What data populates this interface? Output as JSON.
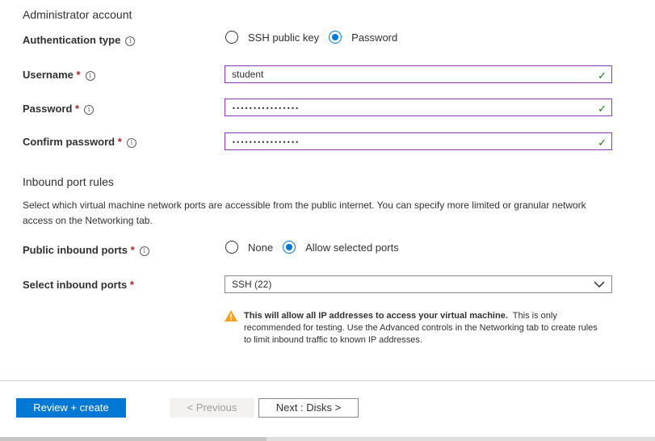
{
  "admin": {
    "section_title": "Administrator account",
    "auth_type_label": "Authentication type",
    "auth_options": [
      "SSH public key",
      "Password"
    ],
    "auth_selected": "Password",
    "username_label": "Username",
    "username_value": "student",
    "password_label": "Password",
    "password_value": "••••••••••••••••",
    "confirm_label": "Confirm password",
    "confirm_value": "••••••••••••••••",
    "required_mark": "*",
    "info_glyph": "i",
    "valid_glyph": "✓"
  },
  "inbound": {
    "section_title": "Inbound port rules",
    "description": "Select which virtual machine network ports are accessible from the public internet. You can specify more limited or granular network access on the Networking tab.",
    "public_ports_label": "Public inbound ports",
    "public_ports_options": [
      "None",
      "Allow selected ports"
    ],
    "public_ports_selected": "Allow selected ports",
    "select_ports_label": "Select inbound ports",
    "select_ports_value": "SSH (22)",
    "warning_bold": "This will allow all IP addresses to access your virtual machine.",
    "warning_text": "This is only recommended for testing.  Use the Advanced controls in the Networking tab to create rules to limit inbound traffic to known IP addresses."
  },
  "footer": {
    "review_create": "Review + create",
    "previous": "< Previous",
    "next": "Next : Disks >"
  },
  "colors": {
    "accent": "#0078d4",
    "field_border": "#8a3ab9",
    "valid": "#107c10",
    "warning": "#f7a11a",
    "required": "#a4262c"
  }
}
